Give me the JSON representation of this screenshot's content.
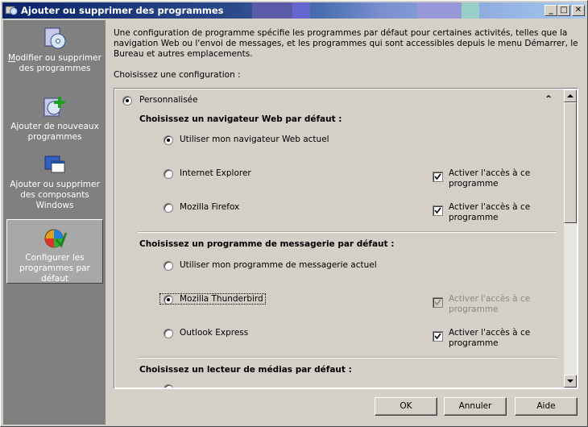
{
  "window": {
    "title": "Ajouter ou supprimer des programmes"
  },
  "title_buttons": {
    "minimize": "_",
    "maximize": "□",
    "close": "✕"
  },
  "sidebar": {
    "items": [
      {
        "label_key": "M",
        "label_rest": "odifier ou supprimer des programmes",
        "icon": "programs-cd-icon"
      },
      {
        "label": "Ajouter de nouveaux programmes",
        "label_key": "n",
        "icon": "add-programs-icon"
      },
      {
        "label": "Ajouter ou supprimer des composants Windows",
        "icon": "windows-components-icon"
      },
      {
        "label": "Configurer les programmes par défaut",
        "icon": "default-programs-icon"
      }
    ]
  },
  "content": {
    "intro": "Une configuration de programme spécifie les programmes par défaut pour certaines activités, telles que la navigation Web ou l'envoi de messages, et les programmes qui sont accessibles depuis le menu Démarrer, le Bureau et autres emplacements.",
    "choose_label": "Choisissez une configuration :",
    "config_name": "Personnalisée",
    "sections": [
      {
        "heading": "Choisissez un navigateur Web par défaut :",
        "options": [
          {
            "label": "Utiliser mon navigateur Web actuel",
            "checkbox": null
          },
          {
            "label": "Internet Explorer",
            "checkbox": "Activer l'accès à ce programme"
          },
          {
            "label": "Mozilla Firefox",
            "checkbox": "Activer l'accès à ce programme"
          }
        ]
      },
      {
        "heading": "Choisissez un programme de messagerie par défaut :",
        "options": [
          {
            "label": "Utiliser mon programme de messagerie actuel",
            "checkbox": null
          },
          {
            "label": "Mozilla Thunderbird",
            "checkbox": "Activer l'accès à ce programme"
          },
          {
            "label": "Outlook Express",
            "checkbox": "Activer l'accès à ce programme"
          }
        ]
      },
      {
        "heading": "Choisissez un lecteur de médias par défaut :",
        "options": []
      }
    ]
  },
  "buttons": {
    "ok": "OK",
    "cancel": "Annuler",
    "help": "Aide"
  },
  "colors": {
    "titlebar": "#0a246a",
    "face": "#d4d0c8",
    "sidebar": "#808080"
  }
}
